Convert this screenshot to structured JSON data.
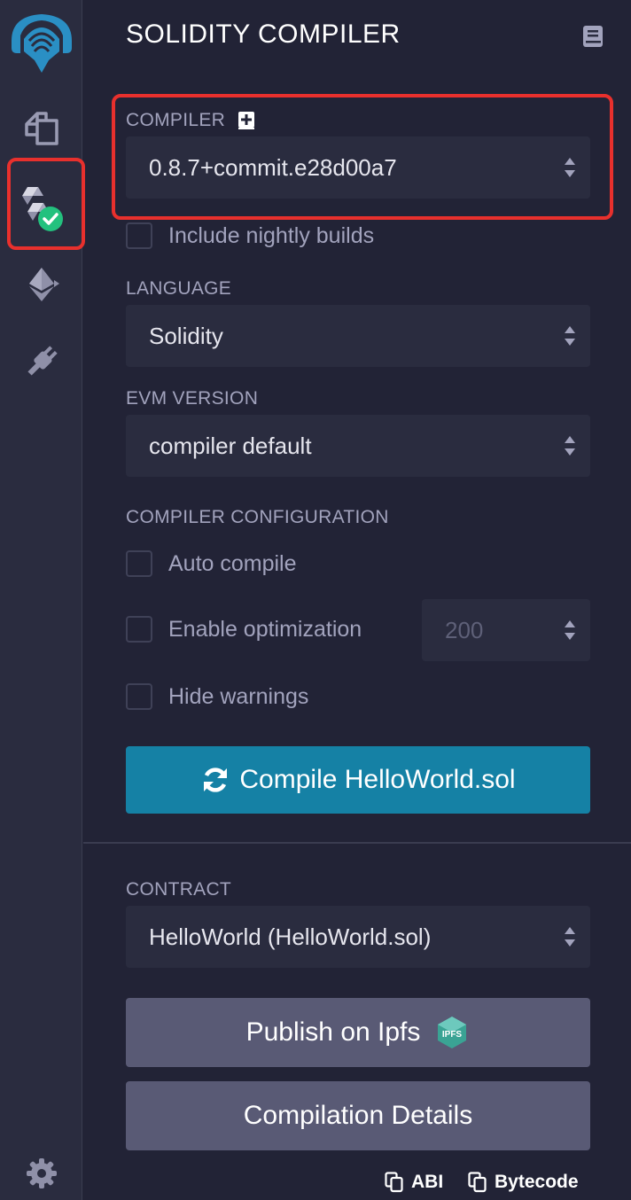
{
  "panel": {
    "title": "SOLIDITY COMPILER"
  },
  "compiler": {
    "label": "COMPILER",
    "version": "0.8.7+commit.e28d00a7",
    "nightly_label": "Include nightly builds"
  },
  "language": {
    "label": "LANGUAGE",
    "value": "Solidity"
  },
  "evm": {
    "label": "EVM VERSION",
    "value": "compiler default"
  },
  "config": {
    "label": "COMPILER CONFIGURATION",
    "auto_compile": "Auto compile",
    "enable_optimization": "Enable optimization",
    "runs_value": "200",
    "hide_warnings": "Hide warnings"
  },
  "compile_button": "Compile HelloWorld.sol",
  "contract": {
    "label": "CONTRACT",
    "value": "HelloWorld (HelloWorld.sol)"
  },
  "publish_button": "Publish on Ipfs",
  "ipfs_badge": "IPFS",
  "details_button": "Compilation Details",
  "footer": {
    "abi": "ABI",
    "bytecode": "Bytecode"
  },
  "rail": {
    "icons": [
      "remix-logo-icon",
      "file-explorer-icon",
      "solidity-compiler-icon",
      "deploy-run-icon",
      "plugin-manager-icon",
      "settings-icon"
    ]
  },
  "colors": {
    "background": "#222336",
    "panel_light": "#2a2c3f",
    "primary_button": "#1581a5",
    "secondary_button": "#595a75",
    "highlight_red": "#e8302d",
    "success_green": "#23c17e"
  }
}
